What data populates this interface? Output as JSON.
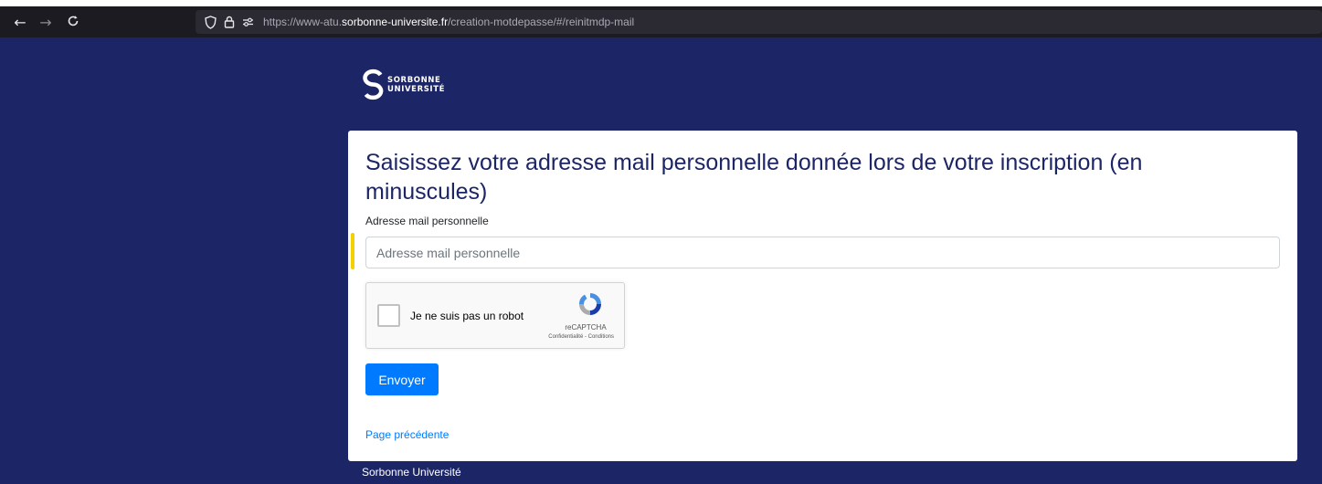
{
  "browser": {
    "url_prefix": "https://www-atu.",
    "url_host": "sorbonne-universite.fr",
    "url_path": "/creation-motdepasse/#/reinitmdp-mail"
  },
  "logo": {
    "line1": "SORBONNE",
    "line2": "UNIVERSITÉ"
  },
  "form": {
    "title": "Saisissez votre adresse mail personnelle donnée lors de votre inscription (en minuscules)",
    "email_label": "Adresse mail personnelle",
    "email_value": "",
    "email_placeholder": "Adresse mail personnelle",
    "submit_label": "Envoyer",
    "back_link": "Page précédente"
  },
  "recaptcha": {
    "label": "Je ne suis pas un robot",
    "brand": "reCAPTCHA",
    "links": "Confidentialité - Conditions",
    "checked": false
  },
  "footer": {
    "text": "Sorbonne Université"
  },
  "colors": {
    "background": "#1c2566",
    "title": "#1c2566",
    "primary": "#007bff",
    "focus_marker": "#f5d000"
  }
}
